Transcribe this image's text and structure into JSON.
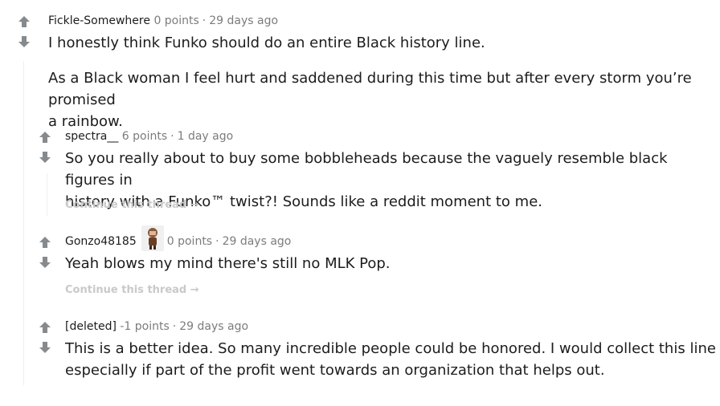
{
  "comments": [
    {
      "author": "Fickle-Somewhere",
      "points": "0 points",
      "age": "29 days ago",
      "body": [
        "I honestly think Funko should do an entire Black history line.",
        "As a Black woman I feel hurt and saddened during this time but after every storm you’re promised",
        "a rainbow."
      ]
    },
    {
      "author": "spectra__",
      "points": "6 points",
      "age": "1 day ago",
      "body": [
        "So you really about to buy some bobbleheads because the vaguely resemble black figures in",
        "history with a Funko™ twist?! Sounds like a reddit moment to me."
      ],
      "continue": "Continue this thread →"
    },
    {
      "author": "Gonzo48185",
      "points": "0 points",
      "age": "29 days ago",
      "body": [
        "Yeah blows my mind there's still no MLK Pop."
      ],
      "continue": "Continue this thread →"
    },
    {
      "author": "[deleted]",
      "points": "-1 points",
      "age": "29 days ago",
      "body": [
        "This is a better idea. So many incredible people could be honored. I would collect this line",
        "especially if part of the profit went towards an organization that helps out."
      ]
    }
  ],
  "colors": {
    "vote_arrow": "#878a8c",
    "continue": "#c8c9cb",
    "meta": "#7c7c7c"
  },
  "icons": {
    "upvote": "arrow-up-icon",
    "downvote": "arrow-down-icon",
    "flair": "funko-figure-flair"
  }
}
